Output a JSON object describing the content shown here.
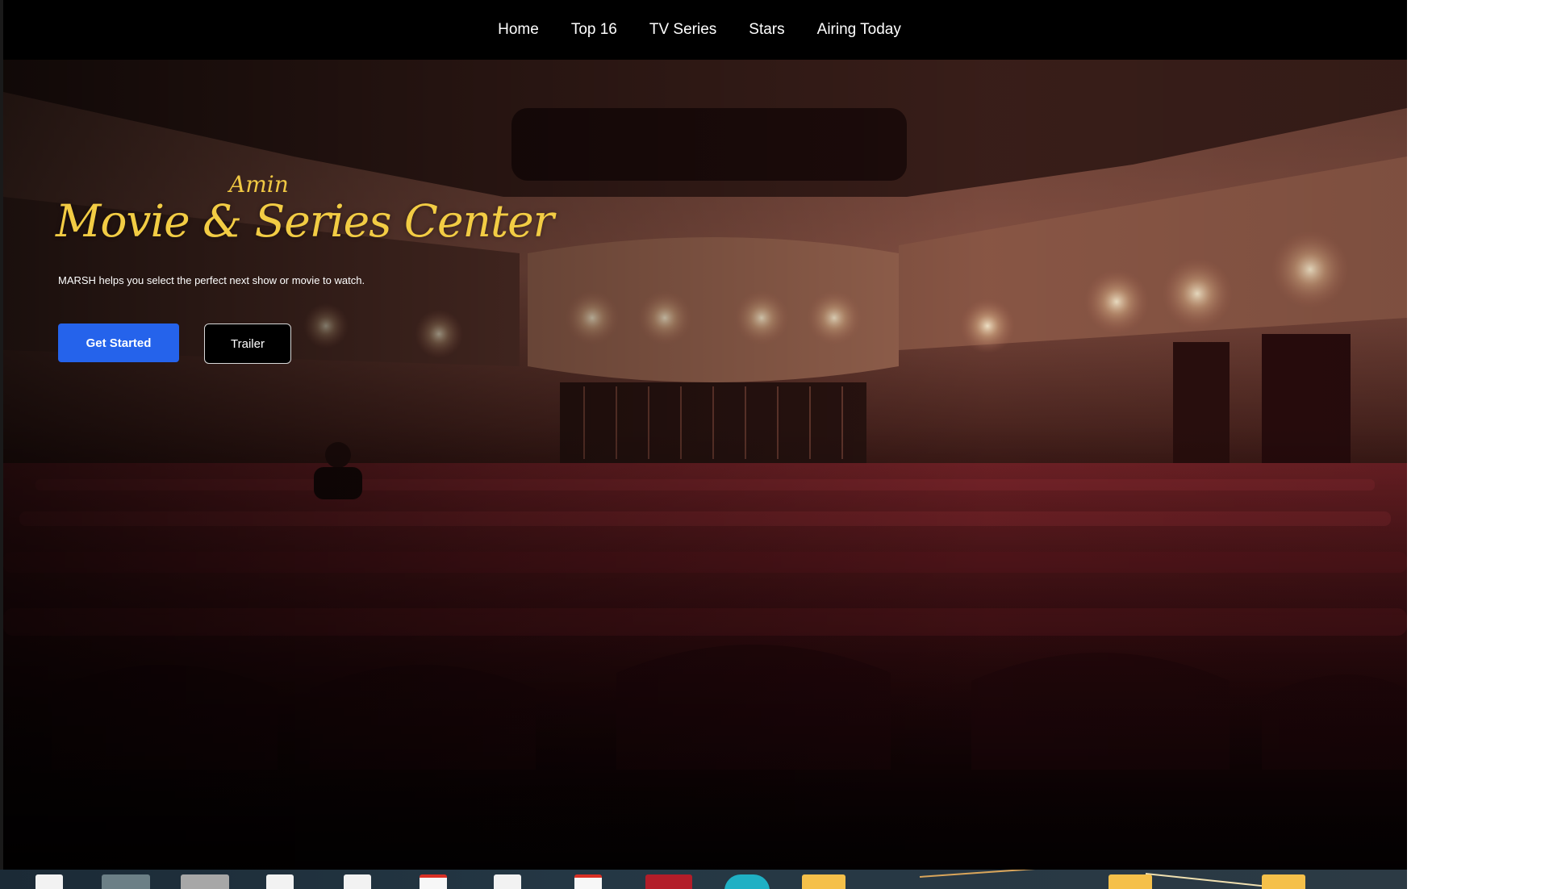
{
  "nav": {
    "items": [
      {
        "label": "Home"
      },
      {
        "label": "Top 16"
      },
      {
        "label": "TV Series"
      },
      {
        "label": "Stars"
      },
      {
        "label": "Airing Today"
      }
    ]
  },
  "hero": {
    "brand_small": "Amin",
    "title": "Movie & Series Center",
    "tagline": "MARSH helps you select the perfect next show or movie to watch.",
    "primary_cta": "Get Started",
    "secondary_cta": "Trailer",
    "background": "theater-auditorium-image"
  },
  "colors": {
    "title_gold": "#f2cc44",
    "primary_button": "#2563eb",
    "nav_bg": "#000000"
  },
  "taskbar": {
    "icons": [
      "document-icon",
      "photo-thumbnail-icon",
      "photo-thumbnail-icon",
      "document-icon",
      "document-icon",
      "pdf-icon",
      "document-icon",
      "pdf-icon",
      "archive-icon",
      "edge-browser-icon",
      "folder-icon",
      "folder-icon",
      "folder-icon"
    ]
  }
}
